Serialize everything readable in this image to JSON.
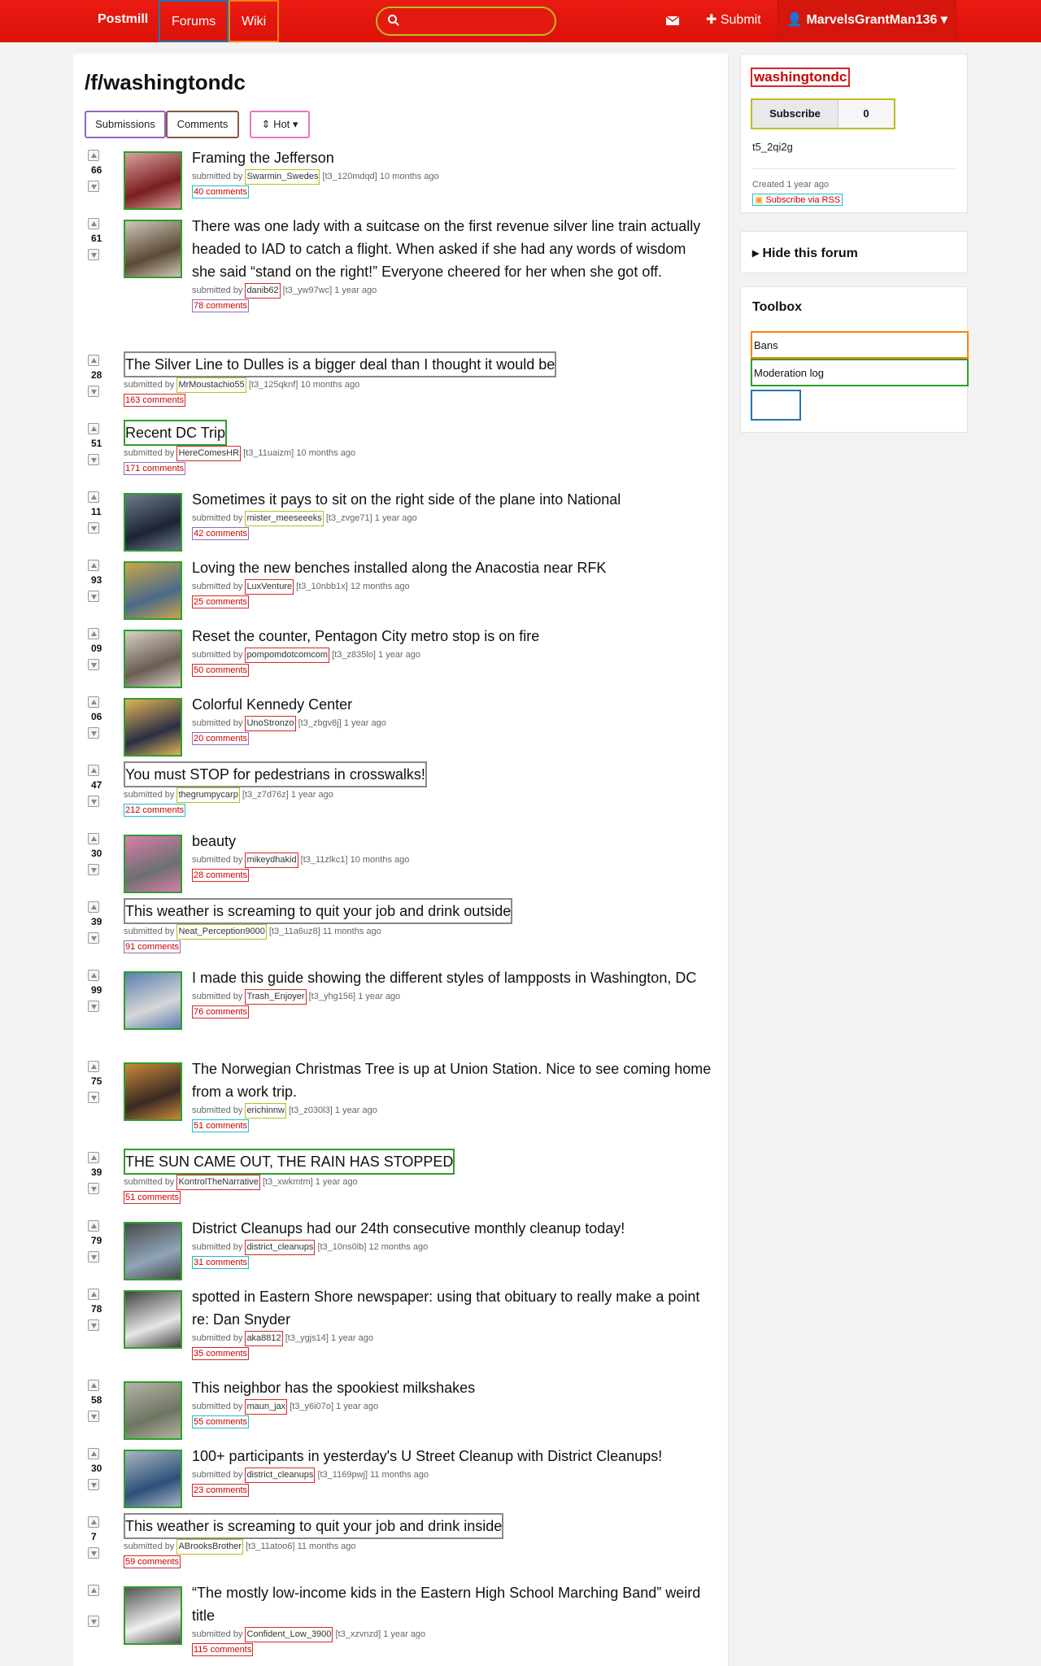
{
  "nav": {
    "brand": "Postmill",
    "forums": "Forums",
    "wiki": "Wiki",
    "search_value": "",
    "submit": "Submit",
    "user": "MarvelsGrantMan136"
  },
  "page": {
    "title": "/f/washingtondc",
    "tabs": {
      "submissions": "Submissions",
      "comments": "Comments",
      "sort": "Hot"
    }
  },
  "posts": [
    {
      "score": "66",
      "title": "Framing the Jefferson",
      "author": "Swarmin_Swedes",
      "id": "[t3_120mdqd]",
      "time": "10 months ago",
      "comments": "40 comments",
      "has_thumb": true
    },
    {
      "score": "61",
      "title": "There was one lady with a suitcase on the first revenue silver line train actually headed to IAD to catch a flight. When asked if she had any words of wisdom she said “stand on the right!” Everyone cheered for her when she got off.",
      "author": "danib62",
      "id": "[t3_yw97wc]",
      "time": "1 year ago",
      "comments": "78 comments",
      "has_thumb": true
    },
    {
      "score": "28",
      "title": "The Silver Line to Dulles is a bigger deal than I thought it would be",
      "author": "MrMoustachio55",
      "id": "[t3_125qknf]",
      "time": "10 months ago",
      "comments": "163 comments",
      "has_thumb": false
    },
    {
      "score": "51",
      "title": "Recent DC Trip",
      "author": "HereComesHR",
      "id": "[t3_11uaizm]",
      "time": "10 months ago",
      "comments": "171 comments",
      "has_thumb": false
    },
    {
      "score": "11",
      "title": "Sometimes it pays to sit on the right side of the plane into National",
      "author": "mister_meeseeeks",
      "id": "[t3_zvge71]",
      "time": "1 year ago",
      "comments": "42 comments",
      "has_thumb": true
    },
    {
      "score": "93",
      "title": "Loving the new benches installed along the Anacostia near RFK",
      "author": "LuxVenture",
      "id": "[t3_10nbb1x]",
      "time": "12 months ago",
      "comments": "25 comments",
      "has_thumb": true
    },
    {
      "score": "09",
      "title": "Reset the counter, Pentagon City metro stop is on fire",
      "author": "pompomdotcomcom",
      "id": "[t3_z835lo]",
      "time": "1 year ago",
      "comments": "50 comments",
      "has_thumb": true
    },
    {
      "score": "06",
      "title": "Colorful Kennedy Center",
      "author": "UnoStronzo",
      "id": "[t3_zbgv8j]",
      "time": "1 year ago",
      "comments": "20 comments",
      "has_thumb": true
    },
    {
      "score": "47",
      "title": "You must STOP for pedestrians in crosswalks!",
      "author": "thegrumpycarp",
      "id": "[t3_z7d76z]",
      "time": "1 year ago",
      "comments": "212 comments",
      "has_thumb": false
    },
    {
      "score": "30",
      "title": "beauty",
      "author": "mikeydhakid",
      "id": "[t3_11zlkc1]",
      "time": "10 months ago",
      "comments": "28 comments",
      "has_thumb": true
    },
    {
      "score": "39",
      "title": "This weather is screaming to quit your job and drink outside",
      "author": "Neat_Perception9000",
      "id": "[t3_11a6uz8]",
      "time": "11 months ago",
      "comments": "91 comments",
      "has_thumb": false
    },
    {
      "score": "99",
      "title": "I made this guide showing the different styles of lampposts in Washington, DC",
      "author": "Trash_Enjoyer",
      "id": "[t3_yhg156]",
      "time": "1 year ago",
      "comments": "76 comments",
      "has_thumb": true
    },
    {
      "score": "75",
      "title": "The Norwegian Christmas Tree is up at Union Station. Nice to see coming home from a work trip.",
      "author": "erichinnw",
      "id": "[t3_z030l3]",
      "time": "1 year ago",
      "comments": "51 comments",
      "has_thumb": true
    },
    {
      "score": "39",
      "title": "THE SUN CAME OUT, THE RAIN HAS STOPPED",
      "author": "KontrolTheNarrative",
      "id": "[t3_xwkmtm]",
      "time": "1 year ago",
      "comments": "51 comments",
      "has_thumb": false
    },
    {
      "score": "79",
      "title": "District Cleanups had our 24th consecutive monthly cleanup today!",
      "author": "district_cleanups",
      "id": "[t3_10ns0lb]",
      "time": "12 months ago",
      "comments": "31 comments",
      "has_thumb": true
    },
    {
      "score": "78",
      "title": "spotted in Eastern Shore newspaper: using that obituary to really make a point re: Dan Snyder",
      "author": "aka8812",
      "id": "[t3_ygjs14]",
      "time": "1 year ago",
      "comments": "35 comments",
      "has_thumb": true
    },
    {
      "score": "58",
      "title": "This neighbor has the spookiest milkshakes",
      "author": "maun_jax",
      "id": "[t3_y6i07o]",
      "time": "1 year ago",
      "comments": "55 comments",
      "has_thumb": true
    },
    {
      "score": "30",
      "title": "100+ participants in yesterday's U Street Cleanup with District Cleanups!",
      "author": "district_cleanups",
      "id": "[t3_1169pwj]",
      "time": "11 months ago",
      "comments": "23 comments",
      "has_thumb": true
    },
    {
      "score": "7",
      "title": "This weather is screaming to quit your job and drink inside",
      "author": "ABrooksBrother",
      "id": "[t3_11atoo6]",
      "time": "11 months ago",
      "comments": "59 comments",
      "has_thumb": false
    },
    {
      "score": "",
      "title": "“The mostly low-income kids in the Eastern High School Marching Band” weird title",
      "author": "Confident_Low_3900",
      "id": "[t3_xzvnzd]",
      "time": "1 year ago",
      "comments": "115 comments",
      "has_thumb": true
    }
  ],
  "sidebar": {
    "forum_name": "washingtondc",
    "subscribe_label": "Subscribe",
    "subscriber_count": "0",
    "forum_id": "t5_2qi2g",
    "created": "Created 1 year ago",
    "rss": "Subscribe via RSS",
    "hide_forum": "Hide this forum",
    "toolbox_title": "Toolbox",
    "toolbox_items": [
      "Bans",
      "Moderation log"
    ]
  },
  "labels": {
    "submitted_by": "submitted by"
  },
  "colors": {
    "navbar": "#e8190f",
    "link_red": "#cc0000"
  }
}
